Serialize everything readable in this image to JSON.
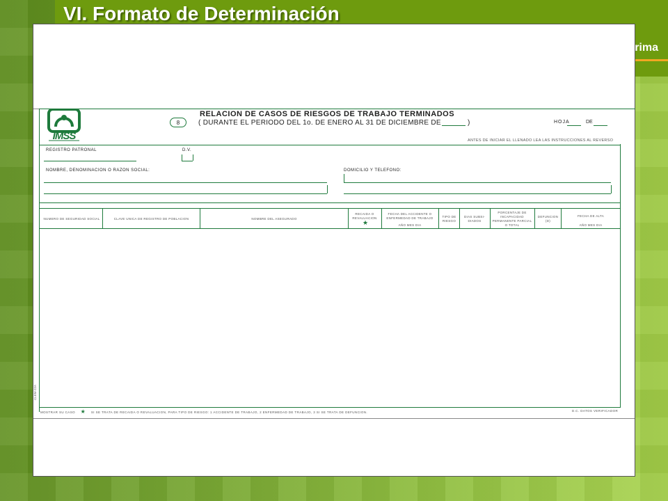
{
  "slide": {
    "title": "VI. Formato de Determinación",
    "subtitle": "Determinación de la Prima"
  },
  "form": {
    "logo_text": "IMSS",
    "badge": "8",
    "title": "RELACION DE CASOS DE RIESGOS DE TRABAJO TERMINADOS",
    "subtitle": "( DURANTE EL PERIODO DEL 1o. DE ENERO AL 31 DE DICIEMBRE DE",
    "close_paren": ")",
    "hoja_label": "HOJA",
    "de_label": "DE",
    "top_note": "ANTES DE INICIAR EL LLENADO LEA LAS INSTRUCCIONES AL REVERSO",
    "registro_patronal_label": "REGISTRO PATRONAL",
    "dv_label": "D.V.",
    "nombre_label": "NOMBRE, DENOMINACION O RAZON SOCIAL:",
    "domicilio_label": "DOMICILIO Y TELEFONO:",
    "columns": [
      {
        "label": "NUMERO DE SEGURIDAD SOCIAL"
      },
      {
        "label": "CLAVE UNICA DE REGISTRO DE POBLACION"
      },
      {
        "label": "NOMBRE DEL ASEGURADO"
      },
      {
        "label": "RECAIDA O REVALUACION"
      },
      {
        "label": "FECHA DEL ACCIDENTE O ENFERMEDAD DE TRABAJO",
        "sub": "AÑO    MES    DIA"
      },
      {
        "label": "TIPO DE RIESGO"
      },
      {
        "label": "DIAS SUBSI-DIADOS"
      },
      {
        "label": "PORCENTAJE DE INCAPACIDAD PERMANENTE PARCIAL O TOTAL"
      },
      {
        "label": "DEFUNCION (D)"
      },
      {
        "label": "FECHA DE ALTA",
        "sub": "AÑO    MES    DIA"
      }
    ],
    "footer_left": "MOSTRAR SU CASO",
    "footer_note": "SI SE TRATA DE RECAIDA O REVALUACION, PARA TIPO DE RIESGO: 1 ACCIDENTE DE TRABAJO, 2 ENFERMEDAD DE TRABAJO, 3 SI SE TRATA DE DEFUNCION.",
    "footer_right": "D.C. DATOS VERIFICADOR",
    "side_code": "CLEM-22A"
  },
  "colors": {
    "bar": "#6e9b0e",
    "accent_line": "#f2a623",
    "form_green": "#1e7a3c"
  }
}
